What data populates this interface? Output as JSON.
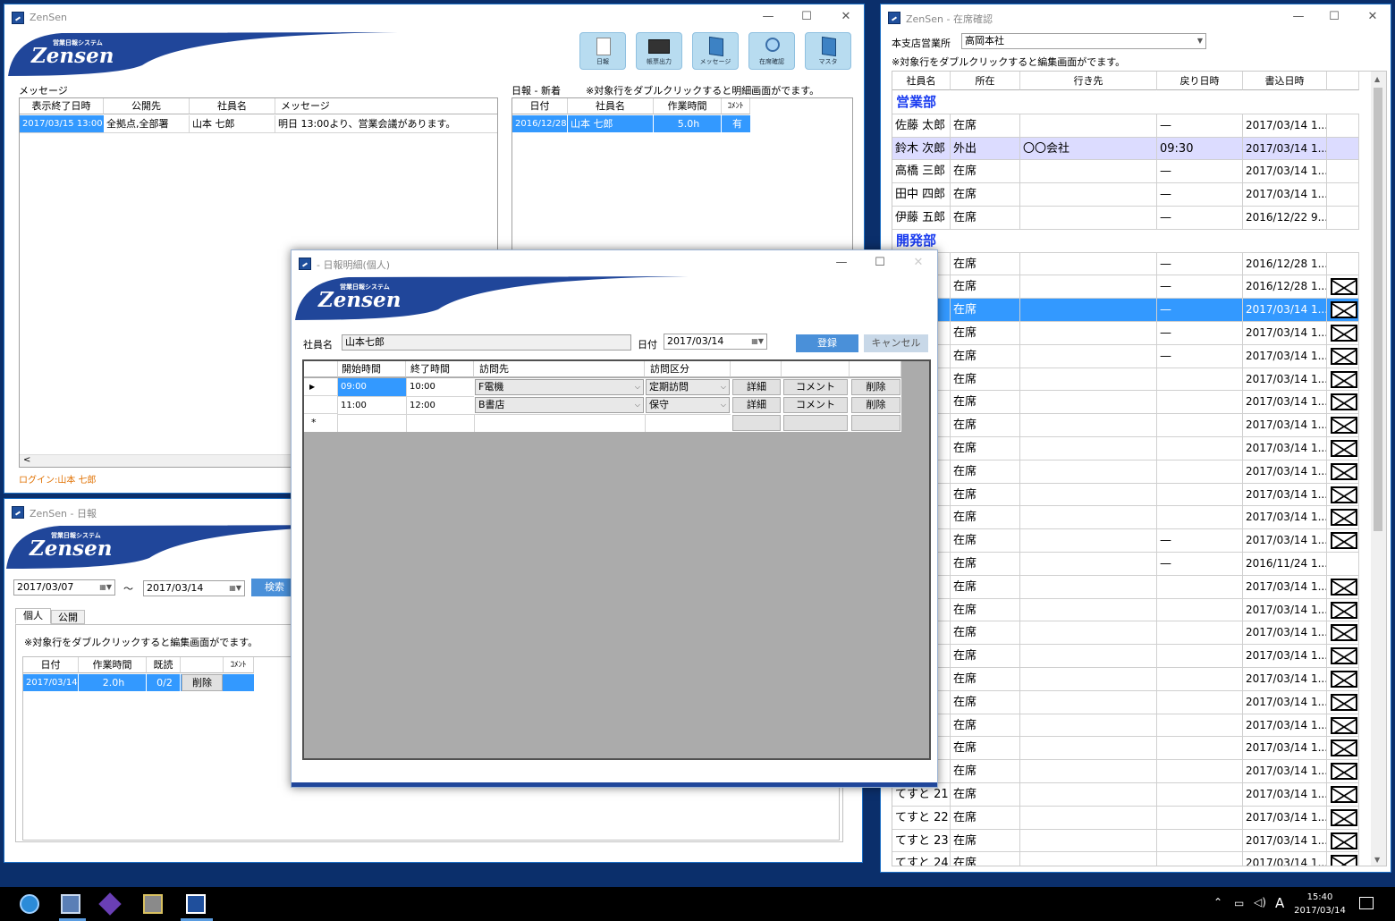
{
  "main": {
    "title": "ZenSen",
    "logo_sub": "営業日報システム",
    "logo_name": "Zensen",
    "toolbar": [
      "日報",
      "帳票出力",
      "メッセージ",
      "在席確認",
      "マスタ"
    ],
    "msg_label": "メッセージ",
    "msg_headers": [
      "表示終了日時",
      "公開先",
      "社員名",
      "メッセージ"
    ],
    "msg_row": [
      "2017/03/15 13:00",
      "全拠点,全部署",
      "山本 七郎",
      "明日 13:00より、営業会議があります。"
    ],
    "nippo_label": "日報 - 新着",
    "nippo_hint": "※対象行をダブルクリックすると明細画面がでます。",
    "nippo_headers": [
      "日付",
      "社員名",
      "作業時間",
      "ｺﾒﾝﾄ"
    ],
    "nippo_row": [
      "2016/12/28",
      "山本 七郎",
      "5.0h",
      "有"
    ],
    "login": "ログイン:山本 七郎"
  },
  "zaiseki": {
    "title": "ZenSen - 在席確認",
    "branch_label": "本支店営業所",
    "branch_value": "高岡本社",
    "hint": "※対象行をダブルクリックすると編集画面がでます。",
    "headers": [
      "社員名",
      "所在",
      "行き先",
      "戻り日時",
      "書込日時"
    ],
    "rows": [
      {
        "type": "dept",
        "label": "営業部"
      },
      {
        "name": "佐藤 太郎",
        "status": "在席",
        "dest": "",
        "ret": "—",
        "time": "2017/03/14 1...",
        "mail": false
      },
      {
        "name": "鈴木 次郎",
        "status": "外出",
        "dest": "〇〇会社",
        "ret": "09:30",
        "time": "2017/03/14 1...",
        "mail": false,
        "hl": true
      },
      {
        "name": "高橋 三郎",
        "status": "在席",
        "dest": "",
        "ret": "—",
        "time": "2017/03/14 1...",
        "mail": false
      },
      {
        "name": "田中 四郎",
        "status": "在席",
        "dest": "",
        "ret": "—",
        "time": "2017/03/14 1...",
        "mail": false
      },
      {
        "name": "伊藤 五郎",
        "status": "在席",
        "dest": "",
        "ret": "—",
        "time": "2016/12/22 9...",
        "mail": false
      },
      {
        "type": "dept",
        "label": "開発部"
      },
      {
        "name": "郎",
        "status": "在席",
        "dest": "",
        "ret": "—",
        "time": "2016/12/28 1...",
        "mail": false
      },
      {
        "name": "郎",
        "status": "在席",
        "dest": "",
        "ret": "—",
        "time": "2016/12/28 1...",
        "mail": true
      },
      {
        "name": "郎",
        "status": "在席",
        "dest": "",
        "ret": "—",
        "time": "2017/03/14 1...",
        "mail": true,
        "sel": true
      },
      {
        "name": "",
        "status": "在席",
        "dest": "",
        "ret": "—",
        "time": "2017/03/14 1...",
        "mail": true
      },
      {
        "name": "",
        "status": "在席",
        "dest": "",
        "ret": "—",
        "time": "2017/03/14 1...",
        "mail": true
      },
      {
        "name": "",
        "status": "在席",
        "dest": "",
        "ret": "",
        "time": "2017/03/14 1...",
        "mail": true
      },
      {
        "name": "",
        "status": "在席",
        "dest": "",
        "ret": "",
        "time": "2017/03/14 1...",
        "mail": true
      },
      {
        "name": "",
        "status": "在席",
        "dest": "",
        "ret": "",
        "time": "2017/03/14 1...",
        "mail": true
      },
      {
        "name": "",
        "status": "在席",
        "dest": "",
        "ret": "",
        "time": "2017/03/14 1...",
        "mail": true
      },
      {
        "name": "",
        "status": "在席",
        "dest": "",
        "ret": "",
        "time": "2017/03/14 1...",
        "mail": true
      },
      {
        "name": "",
        "status": "在席",
        "dest": "",
        "ret": "",
        "time": "2017/03/14 1...",
        "mail": true
      },
      {
        "name": "",
        "status": "在席",
        "dest": "",
        "ret": "",
        "time": "2017/03/14 1...",
        "mail": true
      },
      {
        "name": "",
        "status": "在席",
        "dest": "",
        "ret": "—",
        "time": "2017/03/14 1...",
        "mail": true
      },
      {
        "name": "",
        "status": "在席",
        "dest": "",
        "ret": "—",
        "time": "2016/11/24 1...",
        "mail": false
      },
      {
        "name": "",
        "status": "在席",
        "dest": "",
        "ret": "",
        "time": "2017/03/14 1...",
        "mail": true
      },
      {
        "name": "",
        "status": "在席",
        "dest": "",
        "ret": "",
        "time": "2017/03/14 1...",
        "mail": true
      },
      {
        "name": "",
        "status": "在席",
        "dest": "",
        "ret": "",
        "time": "2017/03/14 1...",
        "mail": true
      },
      {
        "name": "",
        "status": "在席",
        "dest": "",
        "ret": "",
        "time": "2017/03/14 1...",
        "mail": true
      },
      {
        "name": "",
        "status": "在席",
        "dest": "",
        "ret": "",
        "time": "2017/03/14 1...",
        "mail": true
      },
      {
        "name": "",
        "status": "在席",
        "dest": "",
        "ret": "",
        "time": "2017/03/14 1...",
        "mail": true
      },
      {
        "name": "",
        "status": "在席",
        "dest": "",
        "ret": "",
        "time": "2017/03/14 1...",
        "mail": true
      },
      {
        "name": "",
        "status": "在席",
        "dest": "",
        "ret": "",
        "time": "2017/03/14 1...",
        "mail": true
      },
      {
        "name": "",
        "status": "在席",
        "dest": "",
        "ret": "",
        "time": "2017/03/14 1...",
        "mail": true
      },
      {
        "name": "てすと 21",
        "status": "在席",
        "dest": "",
        "ret": "",
        "time": "2017/03/14 1...",
        "mail": true
      },
      {
        "name": "てすと 22",
        "status": "在席",
        "dest": "",
        "ret": "",
        "time": "2017/03/14 1...",
        "mail": true
      },
      {
        "name": "てすと 23",
        "status": "在席",
        "dest": "",
        "ret": "",
        "time": "2017/03/14 1...",
        "mail": true
      },
      {
        "name": "てすと 24",
        "status": "在席",
        "dest": "",
        "ret": "",
        "time": "2017/03/14 1...",
        "mail": true
      }
    ]
  },
  "nippo_list": {
    "title": "ZenSen - 日報",
    "from": "2017/03/07",
    "tilde": "～",
    "to": "2017/03/14",
    "search": "検索",
    "tabs": [
      "個人",
      "公開"
    ],
    "hint": "※対象行をダブルクリックすると編集画面がでます。",
    "headers": [
      "日付",
      "作業時間",
      "既読",
      "",
      "ｺﾒﾝﾄ"
    ],
    "row": [
      "2017/03/14",
      "2.0h",
      "0/2",
      "削除",
      ""
    ]
  },
  "detail": {
    "title": "- 日報明細(個人)",
    "emp_label": "社員名",
    "emp_value": "山本七郎",
    "date_label": "日付",
    "date_value": "2017/03/14",
    "register": "登録",
    "cancel": "キャンセル",
    "headers": [
      "開始時間",
      "終了時間",
      "訪問先",
      "訪問区分"
    ],
    "rows": [
      {
        "start": "09:00",
        "end": "10:00",
        "dest": "F電機",
        "kind": "定期訪問",
        "b1": "詳細",
        "b2": "コメント",
        "b3": "削除"
      },
      {
        "start": "11:00",
        "end": "12:00",
        "dest": "B書店",
        "kind": "保守",
        "b1": "詳細",
        "b2": "コメント",
        "b3": "削除"
      }
    ],
    "new_mark": "*"
  },
  "taskbar": {
    "time": "15:40",
    "date": "2017/03/14",
    "ime": "A"
  }
}
